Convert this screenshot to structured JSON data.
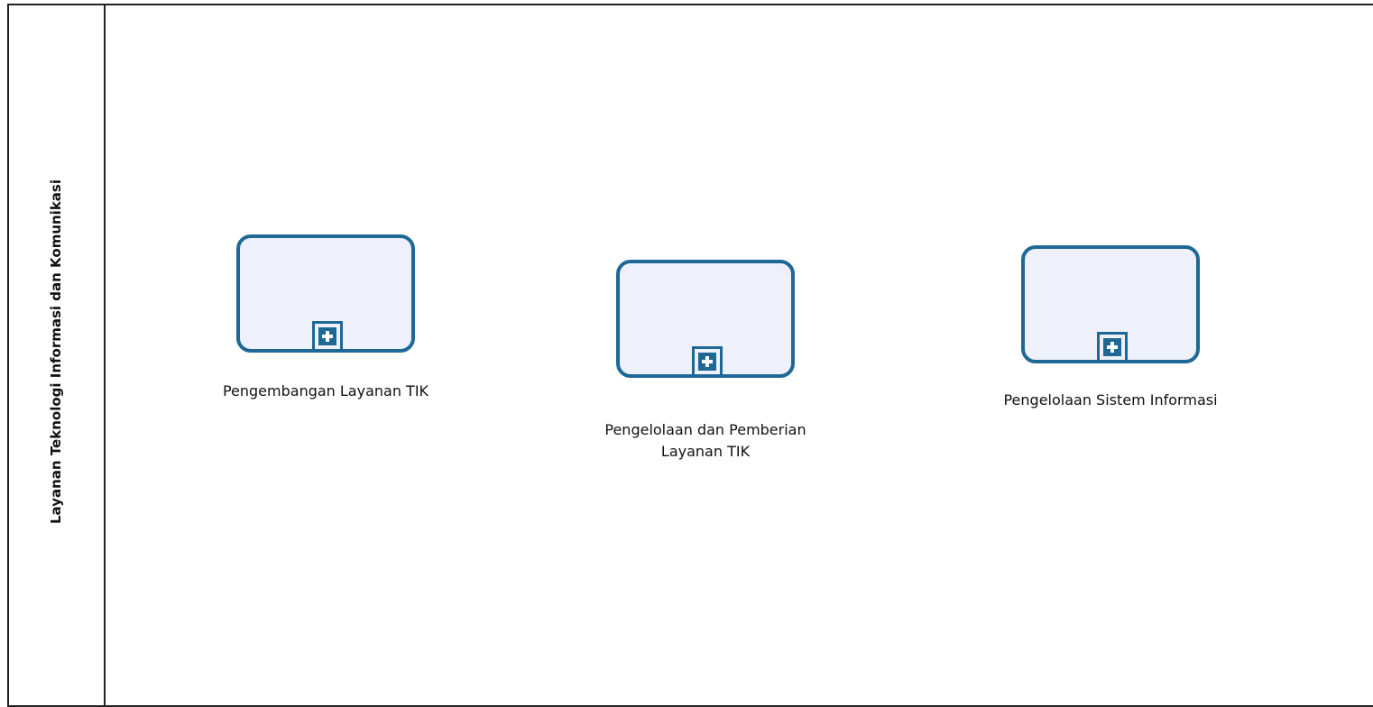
{
  "pool": {
    "lane_title": "Layanan Teknologi Informasi dan Komunikasi"
  },
  "tasks": [
    {
      "label": "Pengembangan Layanan TIK"
    },
    {
      "label": "Pengelolaan dan Pemberian\nLayanan TIK"
    },
    {
      "label": "Pengelolaan Sistem Informasi"
    }
  ],
  "colors": {
    "task_border": "#1f6895",
    "task_fill": "#eef1fc",
    "pool_border": "#222222"
  },
  "icons": {
    "expand_marker": "plus-square-icon"
  }
}
